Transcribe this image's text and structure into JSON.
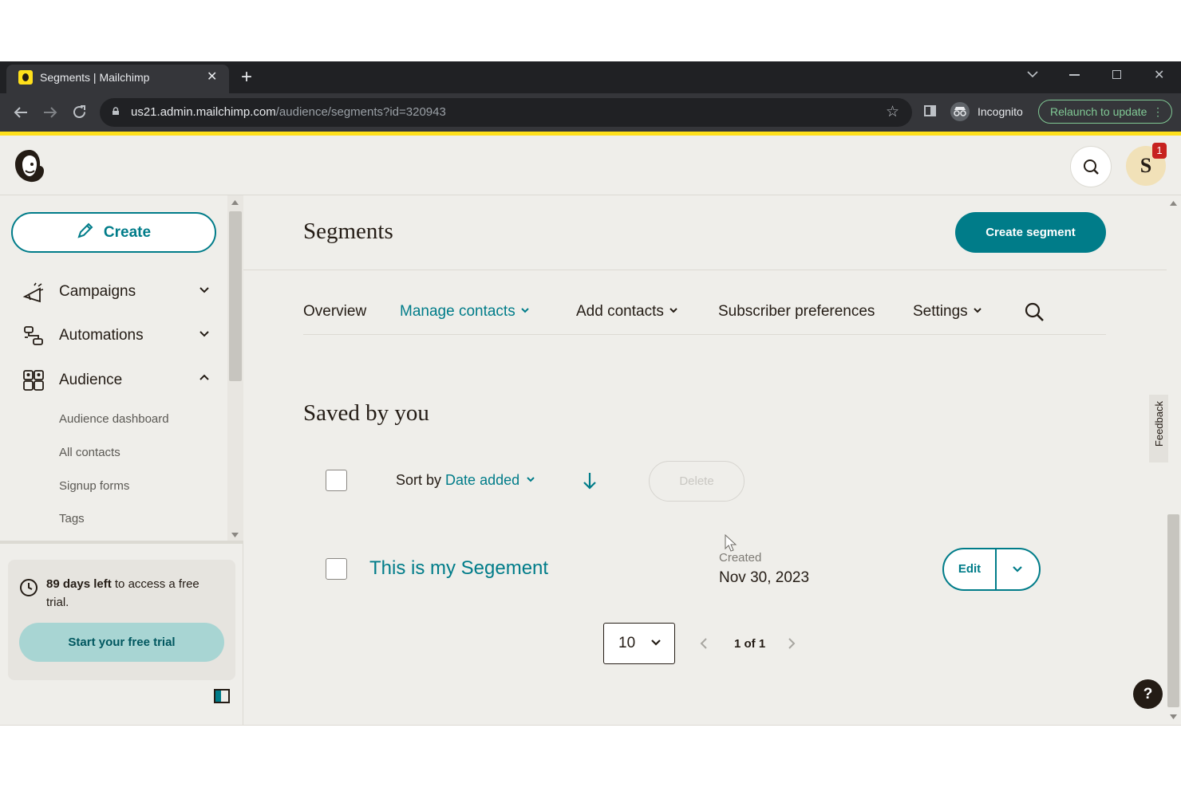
{
  "browser": {
    "tab_title": "Segments | Mailchimp",
    "url_host": "us21.admin.mailchimp.com",
    "url_path": "/audience/segments?id=320943",
    "incognito_label": "Incognito",
    "relaunch_label": "Relaunch to update"
  },
  "header": {
    "avatar_initial": "S",
    "notification_count": "1"
  },
  "sidebar": {
    "create_label": "Create",
    "nav": [
      {
        "label": "Campaigns",
        "expanded": false
      },
      {
        "label": "Automations",
        "expanded": false
      },
      {
        "label": "Audience",
        "expanded": true
      }
    ],
    "sub_items": [
      "Audience dashboard",
      "All contacts",
      "Signup forms",
      "Tags"
    ],
    "trial_bold": "89 days left",
    "trial_text": " to access a free trial.",
    "trial_button": "Start your free trial"
  },
  "main": {
    "title": "Segments",
    "create_segment_label": "Create segment",
    "tabs": [
      {
        "label": "Overview",
        "active": false,
        "dropdown": false
      },
      {
        "label": "Manage contacts",
        "active": true,
        "dropdown": true
      },
      {
        "label": "Add contacts",
        "active": false,
        "dropdown": true
      },
      {
        "label": "Subscriber preferences",
        "active": false,
        "dropdown": false
      },
      {
        "label": "Settings",
        "active": false,
        "dropdown": true
      }
    ],
    "section_title": "Saved by you",
    "sort_prefix": "Sort by",
    "sort_value": "Date added",
    "delete_label": "Delete",
    "segments": [
      {
        "name": "This is my Segement",
        "created_label": "Created",
        "created_date": "Nov 30, 2023",
        "edit_label": "Edit"
      }
    ],
    "page_size": "10",
    "pagination": "1 of 1",
    "feedback_label": "Feedback",
    "help_label": "?"
  },
  "colors": {
    "brand_teal": "#007c89",
    "accent_yellow": "#ffe01b",
    "background": "#efeeea"
  }
}
